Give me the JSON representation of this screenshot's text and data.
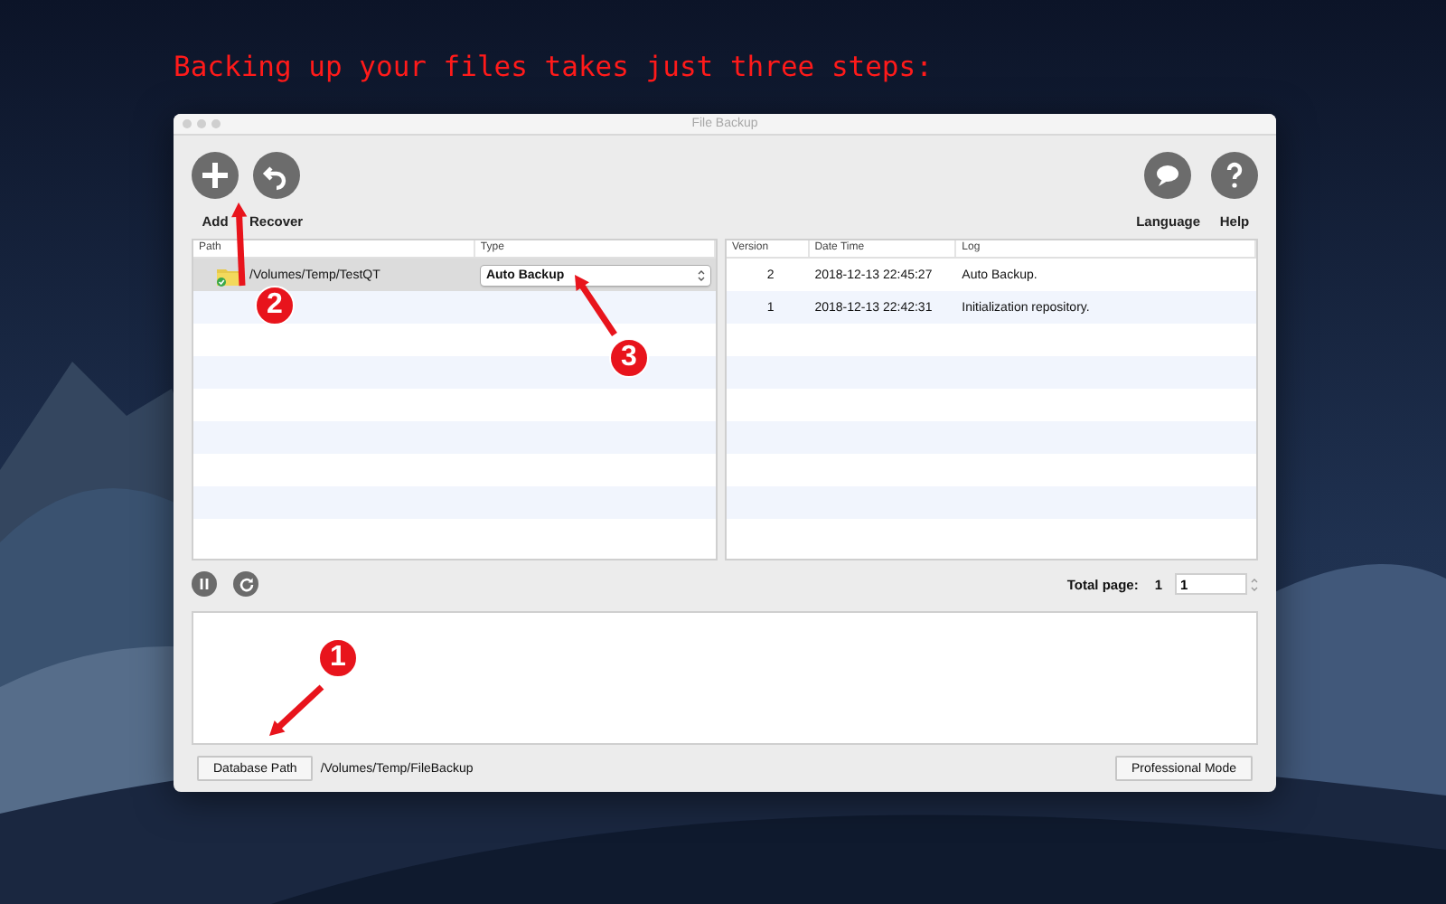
{
  "heading": "Backing up your files takes just three steps:",
  "window": {
    "title": "File Backup"
  },
  "toolbar": {
    "left": [
      {
        "label": "Add"
      },
      {
        "label": "Recover"
      }
    ],
    "right": [
      {
        "label": "Language"
      },
      {
        "label": "Help"
      }
    ]
  },
  "paths_table": {
    "columns": [
      "Path",
      "Type"
    ],
    "rows": [
      {
        "path": "/Volumes/Temp/TestQT",
        "type": "Auto Backup",
        "selected": true
      }
    ]
  },
  "versions_table": {
    "columns": [
      "Version",
      "Date Time",
      "Log"
    ],
    "rows": [
      {
        "version": "2",
        "date_time": "2018-12-13 22:45:27",
        "log": "Auto Backup."
      },
      {
        "version": "1",
        "date_time": "2018-12-13 22:42:31",
        "log": "Initialization repository."
      }
    ]
  },
  "pager": {
    "label": "Total page:",
    "total": "1",
    "page": "1"
  },
  "database_path": {
    "button": "Database Path",
    "value": "/Volumes/Temp/FileBackup"
  },
  "mode_button": "Professional Mode",
  "steps": [
    {
      "number": "1"
    },
    {
      "number": "2"
    },
    {
      "number": "3"
    }
  ]
}
